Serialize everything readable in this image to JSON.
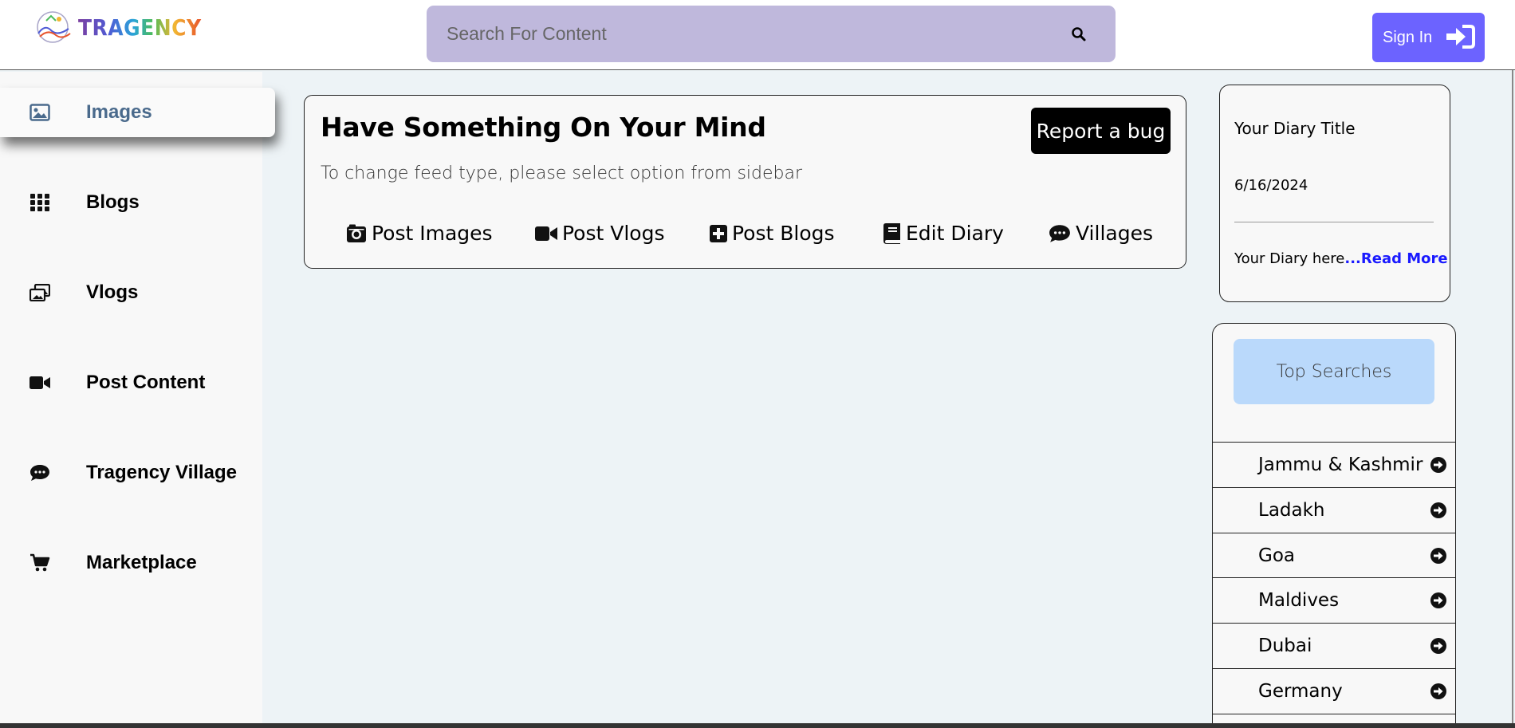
{
  "header": {
    "logo_text": "TRAGENCY",
    "search_placeholder": "Search For Content",
    "signin_label": "Sign In",
    "accent_color": "#6c63ff",
    "search_bg": "#bfb8dc"
  },
  "sidebar": {
    "items": [
      {
        "label": "Images",
        "icon": "image-icon",
        "active": true
      },
      {
        "label": "Blogs",
        "icon": "grid-icon"
      },
      {
        "label": "Vlogs",
        "icon": "photo-stack-icon"
      },
      {
        "label": "Post Content",
        "icon": "video-icon"
      },
      {
        "label": "Tragency Village",
        "icon": "chat-icon"
      },
      {
        "label": "Marketplace",
        "icon": "cart-icon"
      }
    ]
  },
  "feed": {
    "title": "Have Something On Your Mind",
    "subtitle": "To change feed type, please select option from sidebar",
    "report_bug_label": "Report a bug",
    "actions": [
      {
        "label": "Post Images",
        "icon": "camera-icon"
      },
      {
        "label": "Post Vlogs",
        "icon": "video-icon"
      },
      {
        "label": "Post Blogs",
        "icon": "plus-square-icon"
      },
      {
        "label": "Edit Diary",
        "icon": "book-icon"
      },
      {
        "label": "Villages",
        "icon": "chat-icon"
      }
    ]
  },
  "diary": {
    "title": "Your Diary Title",
    "date": "6/16/2024",
    "body": "Your Diary here",
    "read_more": "...Read More"
  },
  "top_searches": {
    "heading": "Top Searches",
    "items": [
      "Jammu & Kashmir",
      "Ladakh",
      "Goa",
      "Maldives",
      "Dubai",
      "Germany"
    ]
  }
}
